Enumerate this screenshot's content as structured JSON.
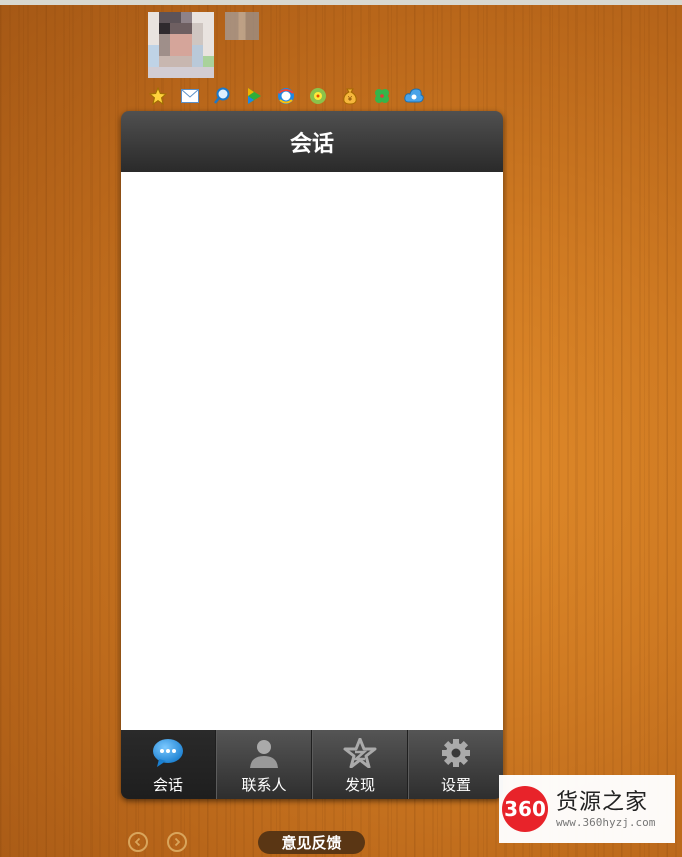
{
  "window": {
    "title": "会话"
  },
  "tabs": [
    {
      "label": "会话",
      "icon": "chat-bubble-icon"
    },
    {
      "label": "联系人",
      "icon": "contact-person-icon"
    },
    {
      "label": "发现",
      "icon": "discover-star-icon"
    },
    {
      "label": "设置",
      "icon": "settings-gear-icon"
    }
  ],
  "app_icons": [
    "favorite-star-icon",
    "mail-icon",
    "search-icon",
    "video-play-icon",
    "browser-icon",
    "game-icon",
    "money-bag-icon",
    "clover-icon",
    "cloud-icon"
  ],
  "footer": {
    "feedback_label": "意见反馈"
  },
  "watermark": {
    "logo_text": "360",
    "name": "货源之家",
    "url": "www.360hyzj.com"
  },
  "colors": {
    "accent_blue": "#2a9be0",
    "titlebar": "#333333",
    "tabbar": "#3a3a3a",
    "feedback_bg": "#5a3614",
    "watermark_red": "#e8232a"
  }
}
